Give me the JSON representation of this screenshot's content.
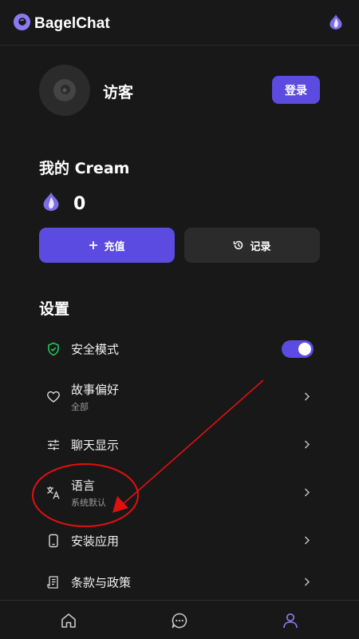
{
  "app": {
    "name": "BagelChat"
  },
  "profile": {
    "name": "访客",
    "login_label": "登录"
  },
  "cream": {
    "title": "我的 Cream",
    "balance": "0",
    "recharge_label": "充值",
    "record_label": "记录"
  },
  "settings": {
    "title": "设置",
    "items": [
      {
        "label": "安全模式",
        "icon": "shield-check-icon",
        "toggle_on": true
      },
      {
        "label": "故事偏好",
        "sublabel": "全部",
        "icon": "heart-icon"
      },
      {
        "label": "聊天显示",
        "icon": "sliders-icon"
      },
      {
        "label": "语言",
        "sublabel": "系统默认",
        "icon": "translate-icon"
      },
      {
        "label": "安装应用",
        "icon": "phone-icon"
      },
      {
        "label": "条款与政策",
        "icon": "document-icon"
      }
    ]
  },
  "nav": {
    "items": [
      "home-icon",
      "chat-icon",
      "profile-icon"
    ],
    "active": "profile-icon"
  },
  "colors": {
    "accent": "#5b4be0",
    "background": "#181818",
    "card": "#2b2b2b",
    "shield": "#22c55e",
    "annotation": "#e01010"
  }
}
